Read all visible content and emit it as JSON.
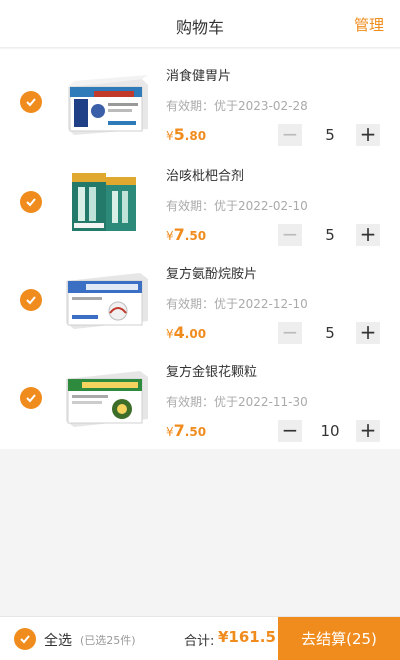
{
  "header": {
    "title": "购物车",
    "manage": "管理"
  },
  "colors": {
    "accent": "#f08c1e"
  },
  "items": [
    {
      "name": "消食健胃片",
      "expiry": "有效期：优于2023-02-28",
      "price_symbol": "¥",
      "price_int": "5",
      "price_dec": ".80",
      "quantity": "5",
      "minus_disabled": true
    },
    {
      "name": "治咳枇杷合剂",
      "expiry": "有效期：优于2022-02-10",
      "price_symbol": "¥",
      "price_int": "7",
      "price_dec": ".50",
      "quantity": "5",
      "minus_disabled": true
    },
    {
      "name": "复方氨酚烷胺片",
      "expiry": "有效期：优于2022-12-10",
      "price_symbol": "¥",
      "price_int": "4",
      "price_dec": ".00",
      "quantity": "5",
      "minus_disabled": true
    },
    {
      "name": "复方金银花颗粒",
      "expiry": "有效期：优于2022-11-30",
      "price_symbol": "¥",
      "price_int": "7",
      "price_dec": ".50",
      "quantity": "10",
      "minus_disabled": false
    }
  ],
  "stepper": {
    "minus": "−",
    "plus": "+"
  },
  "footer": {
    "select_all": "全选",
    "selected": "(已选25件)",
    "total_label": "合计:",
    "total_value": "¥161.5",
    "checkout": "去结算(25)"
  }
}
